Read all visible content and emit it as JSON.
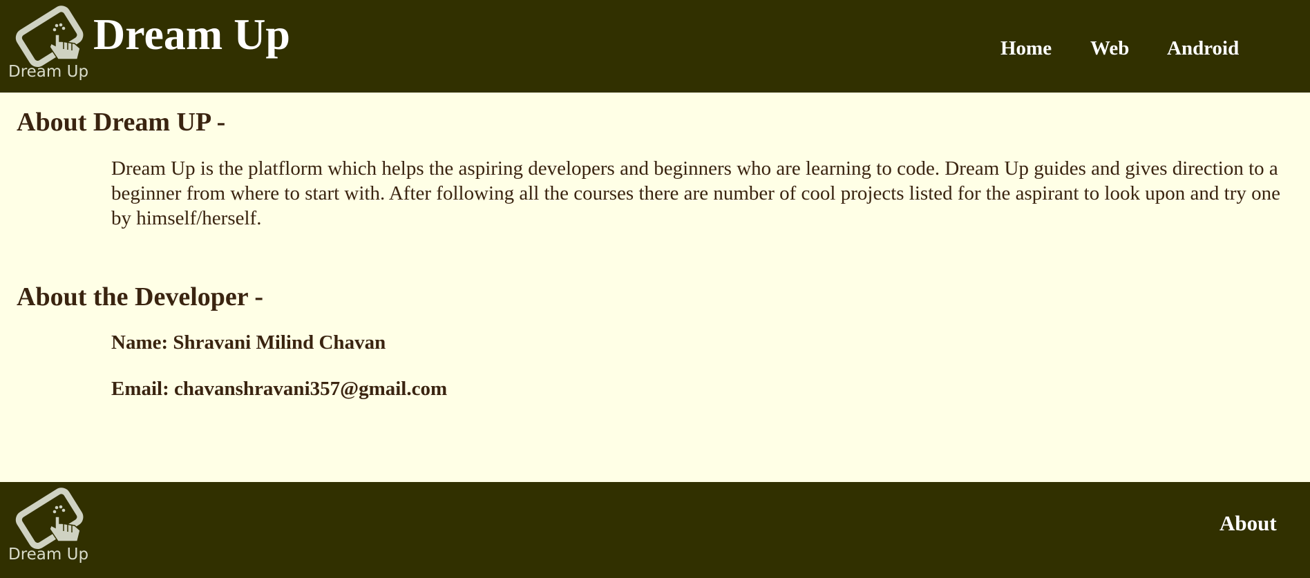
{
  "header": {
    "logo_caption": "Dream Up",
    "title": "Dream Up",
    "nav": {
      "home": "Home",
      "web": "Web",
      "android": "Android"
    }
  },
  "main": {
    "about_heading": "About Dream UP -",
    "about_text": "Dream Up is the platflorm which helps the aspiring developers and beginners who are learning to code. Dream Up guides and gives direction to a beginner from where to start with. After following all the courses there are number of cool projects listed for the aspirant to look upon and try one by himself/herself.",
    "developer_heading": "About the Developer -",
    "developer_name": "Name: Shravani Milind Chavan",
    "developer_email": "Email: chavanshravani357@gmail.com"
  },
  "footer": {
    "logo_caption": "Dream Up",
    "about_link": "About"
  },
  "colors": {
    "bar_background": "#313000",
    "page_background": "#FFFFE6",
    "text": "#3a2410",
    "logo": "#cfd2c2"
  },
  "icons": {
    "logo": "tablet-touch-hand-icon"
  }
}
